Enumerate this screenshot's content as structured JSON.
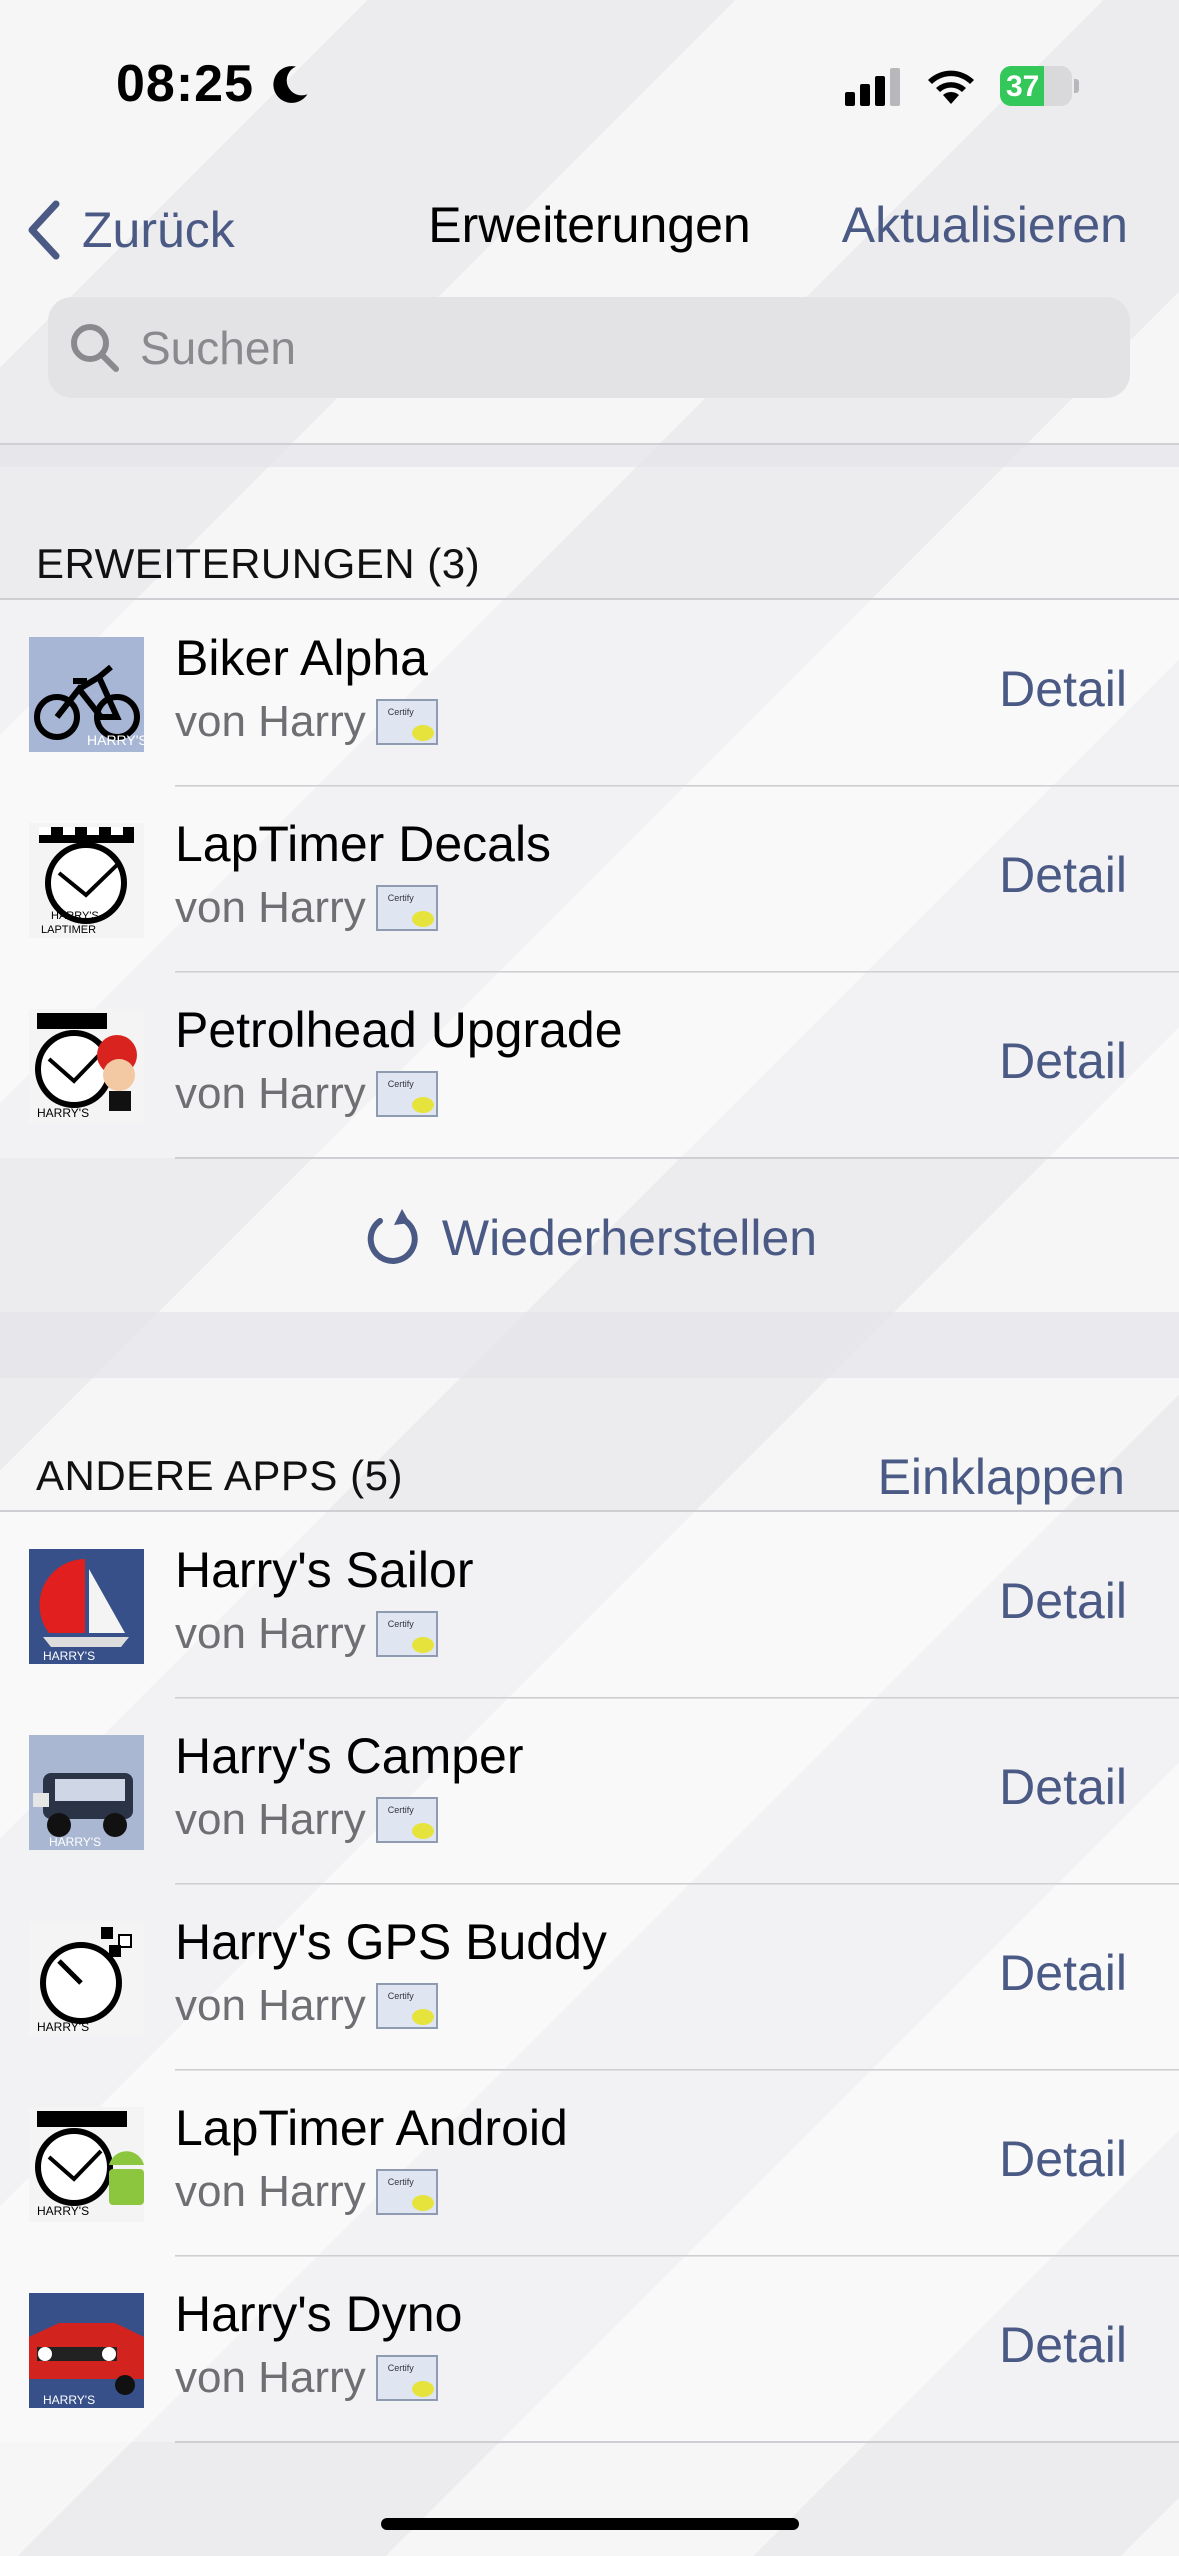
{
  "status_bar": {
    "time": "08:25",
    "battery": "37"
  },
  "nav": {
    "back_label": "Zurück",
    "title": "Erweiterungen",
    "action_label": "Aktualisieren"
  },
  "search": {
    "placeholder": "Suchen"
  },
  "sections": [
    {
      "header": "ERWEITERUNGEN (3)",
      "items": [
        {
          "title": "Biker Alpha",
          "subtitle": "von Harry",
          "action": "Detail",
          "icon": "biker-alpha-icon"
        },
        {
          "title": "LapTimer Decals",
          "subtitle": "von Harry",
          "action": "Detail",
          "icon": "laptimer-decals-icon"
        },
        {
          "title": "Petrolhead Upgrade",
          "subtitle": "von Harry",
          "action": "Detail",
          "icon": "petrolhead-upgrade-icon"
        }
      ],
      "footer_action": "Wiederherstellen"
    },
    {
      "header": "ANDERE APPS (5)",
      "header_action": "Einklappen",
      "items": [
        {
          "title": "Harry's Sailor",
          "subtitle": "von Harry",
          "action": "Detail",
          "icon": "sailor-icon"
        },
        {
          "title": "Harry's Camper",
          "subtitle": "von Harry",
          "action": "Detail",
          "icon": "camper-icon"
        },
        {
          "title": "Harry's GPS Buddy",
          "subtitle": "von Harry",
          "action": "Detail",
          "icon": "gps-buddy-icon"
        },
        {
          "title": "LapTimer Android",
          "subtitle": "von Harry",
          "action": "Detail",
          "icon": "laptimer-android-icon"
        },
        {
          "title": "Harry's Dyno",
          "subtitle": "von Harry",
          "action": "Detail",
          "icon": "dyno-icon"
        }
      ]
    }
  ],
  "badge_text": "Certify",
  "colors": {
    "accent": "#4b5a85",
    "battery_green": "#34c759"
  }
}
